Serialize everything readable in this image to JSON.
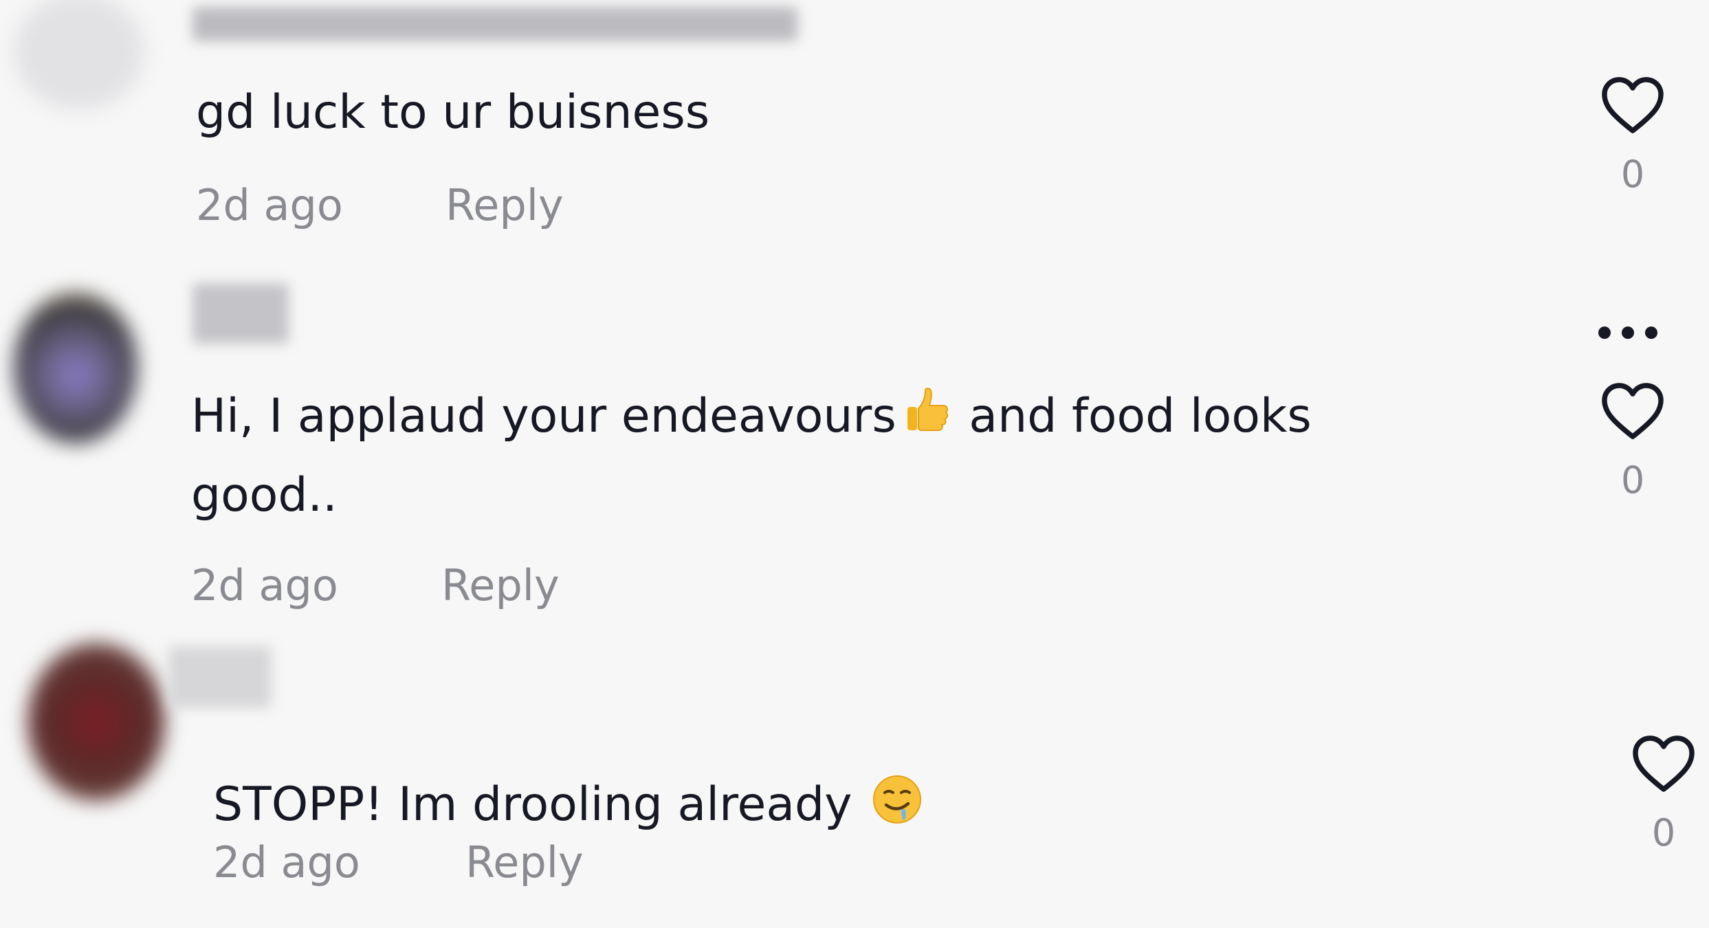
{
  "comments": [
    {
      "text": "gd luck to ur buisness",
      "time": "2d ago",
      "reply_label": "Reply",
      "likes": "0"
    },
    {
      "text_line1_a": "Hi, I applaud your endeavours",
      "text_line1_b": " and food looks",
      "text_line2": "good..",
      "time": "2d ago",
      "reply_label": "Reply",
      "likes": "0"
    },
    {
      "text": "STOPP! Im drooling already ",
      "time": "2d ago",
      "reply_label": "Reply",
      "likes": "0"
    }
  ],
  "icons": {
    "like": "heart-outline-icon",
    "more": "more-options-icon",
    "thumbs_up": "thumbs-up-emoji",
    "drooling": "drooling-face-emoji"
  },
  "colors": {
    "background": "#f7f7f7",
    "text": "#161823",
    "muted": "#8a8b91"
  }
}
